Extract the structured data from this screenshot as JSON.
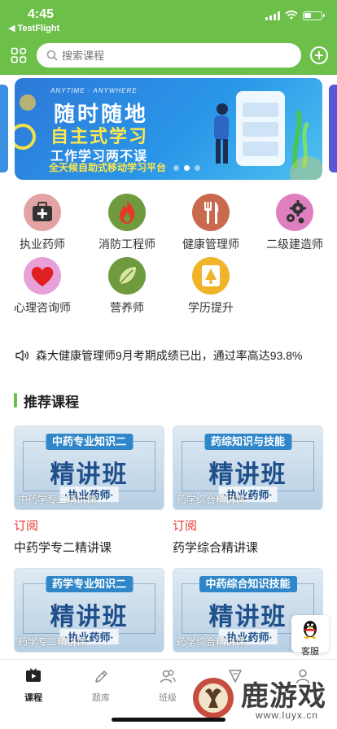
{
  "status": {
    "time": "4:45",
    "back_label": "◀ TestFlight"
  },
  "header": {
    "search_placeholder": "搜索课程",
    "grid_icon": "grid-apps-icon",
    "plus_icon": "plus-circle-icon"
  },
  "banner": {
    "sub": "ANYTIME · ANYWHERE",
    "line1": "随时随地",
    "line2": "自主式学习",
    "line3": "工作学习两不误",
    "line4": "全天候自助式移动学习平台",
    "page_index": 1,
    "page_count": 3
  },
  "categories": [
    {
      "label": "执业药师",
      "icon": "medical-kit-icon",
      "color": "#e3a3a4"
    },
    {
      "label": "消防工程师",
      "icon": "fire-icon",
      "color": "#6f9a3d"
    },
    {
      "label": "健康管理师",
      "icon": "fork-knife-icon",
      "color": "#c96a4f"
    },
    {
      "label": "二级建造师",
      "icon": "gears-icon",
      "color": "#e07fc0"
    },
    {
      "label": "心理咨询师",
      "icon": "heart-icon",
      "color": "#e7a1d8"
    },
    {
      "label": "营养师",
      "icon": "leaf-icon",
      "color": "#6f9a3d"
    },
    {
      "label": "学历提升",
      "icon": "graduation-icon",
      "color": "#f0b32a"
    }
  ],
  "notice": {
    "icon": "speaker-icon",
    "text": "森大健康管理师9月考期成绩已出，通过率高达93.8%"
  },
  "section": {
    "title": "推荐课程"
  },
  "courses": [
    {
      "pill": "中药专业知识二",
      "big": "精讲班",
      "tag": "·执业药师·",
      "overlay": "中药学专二精讲课",
      "sub_label": "订阅",
      "name": "中药学专二精讲课"
    },
    {
      "pill": "药综知识与技能",
      "big": "精讲班",
      "tag": "·执业药师·",
      "overlay": "药学综合精讲课",
      "sub_label": "订阅",
      "name": "药学综合精讲课"
    },
    {
      "pill": "药学专业知识二",
      "big": "精讲班",
      "tag": "·执业药师·",
      "overlay": "药学专二精讲课",
      "sub_label": "",
      "name": ""
    },
    {
      "pill": "中药综合知识技能",
      "big": "精讲班",
      "tag": "·执业药师·",
      "overlay": "药学综合精讲课",
      "sub_label": "",
      "name": ""
    }
  ],
  "kefu": {
    "label": "客服",
    "icon": "qq-penguin-icon"
  },
  "tabs": [
    {
      "label": "课程",
      "icon": "play-tv-icon",
      "active": true
    },
    {
      "label": "题库",
      "icon": "pen-icon",
      "active": false
    },
    {
      "label": "班级",
      "icon": "users-icon",
      "active": false
    },
    {
      "label": "",
      "icon": "badge-icon",
      "active": false
    },
    {
      "label": "",
      "icon": "user-icon",
      "active": false
    }
  ],
  "watermark": {
    "text": "鹿游戏",
    "url": "www.luyx.cn"
  }
}
